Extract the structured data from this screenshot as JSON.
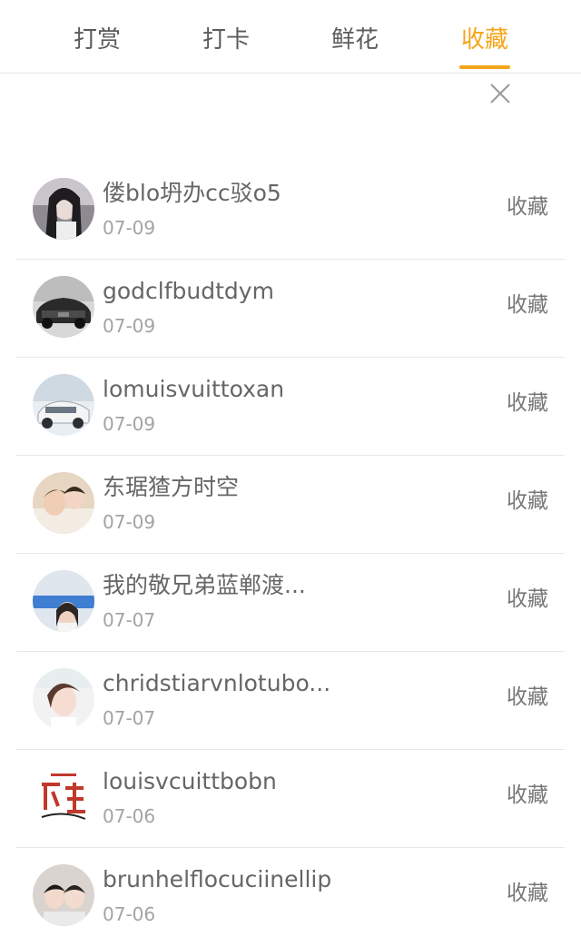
{
  "tabs": [
    {
      "label": "打赏"
    },
    {
      "label": "打卡"
    },
    {
      "label": "鲜花"
    },
    {
      "label": "收藏",
      "active": true
    }
  ],
  "colors": {
    "accent": "#f5a519",
    "text": "#666666",
    "date": "#a3a3a3",
    "divider": "#e8e8e8"
  },
  "close_icon": "close-icon",
  "items": [
    {
      "name": "偻blo坍办cc驳o5",
      "date": "07-09",
      "action": "收藏"
    },
    {
      "name": "godclfbudtdym",
      "date": "07-09",
      "action": "收藏"
    },
    {
      "name": "lomuisvuittoxan",
      "date": "07-09",
      "action": "收藏"
    },
    {
      "name": "东琚猹方时空",
      "date": "07-09",
      "action": "收藏"
    },
    {
      "name": "我的敬兄弟蓝郸渡...",
      "date": "07-07",
      "action": "收藏"
    },
    {
      "name": "chridstiarvnlotubo...",
      "date": "07-07",
      "action": "收藏"
    },
    {
      "name": "louisvcuittbobn",
      "date": "07-06",
      "action": "收藏"
    },
    {
      "name": "brunhelflocuciinellip",
      "date": "07-06",
      "action": "收藏"
    }
  ]
}
